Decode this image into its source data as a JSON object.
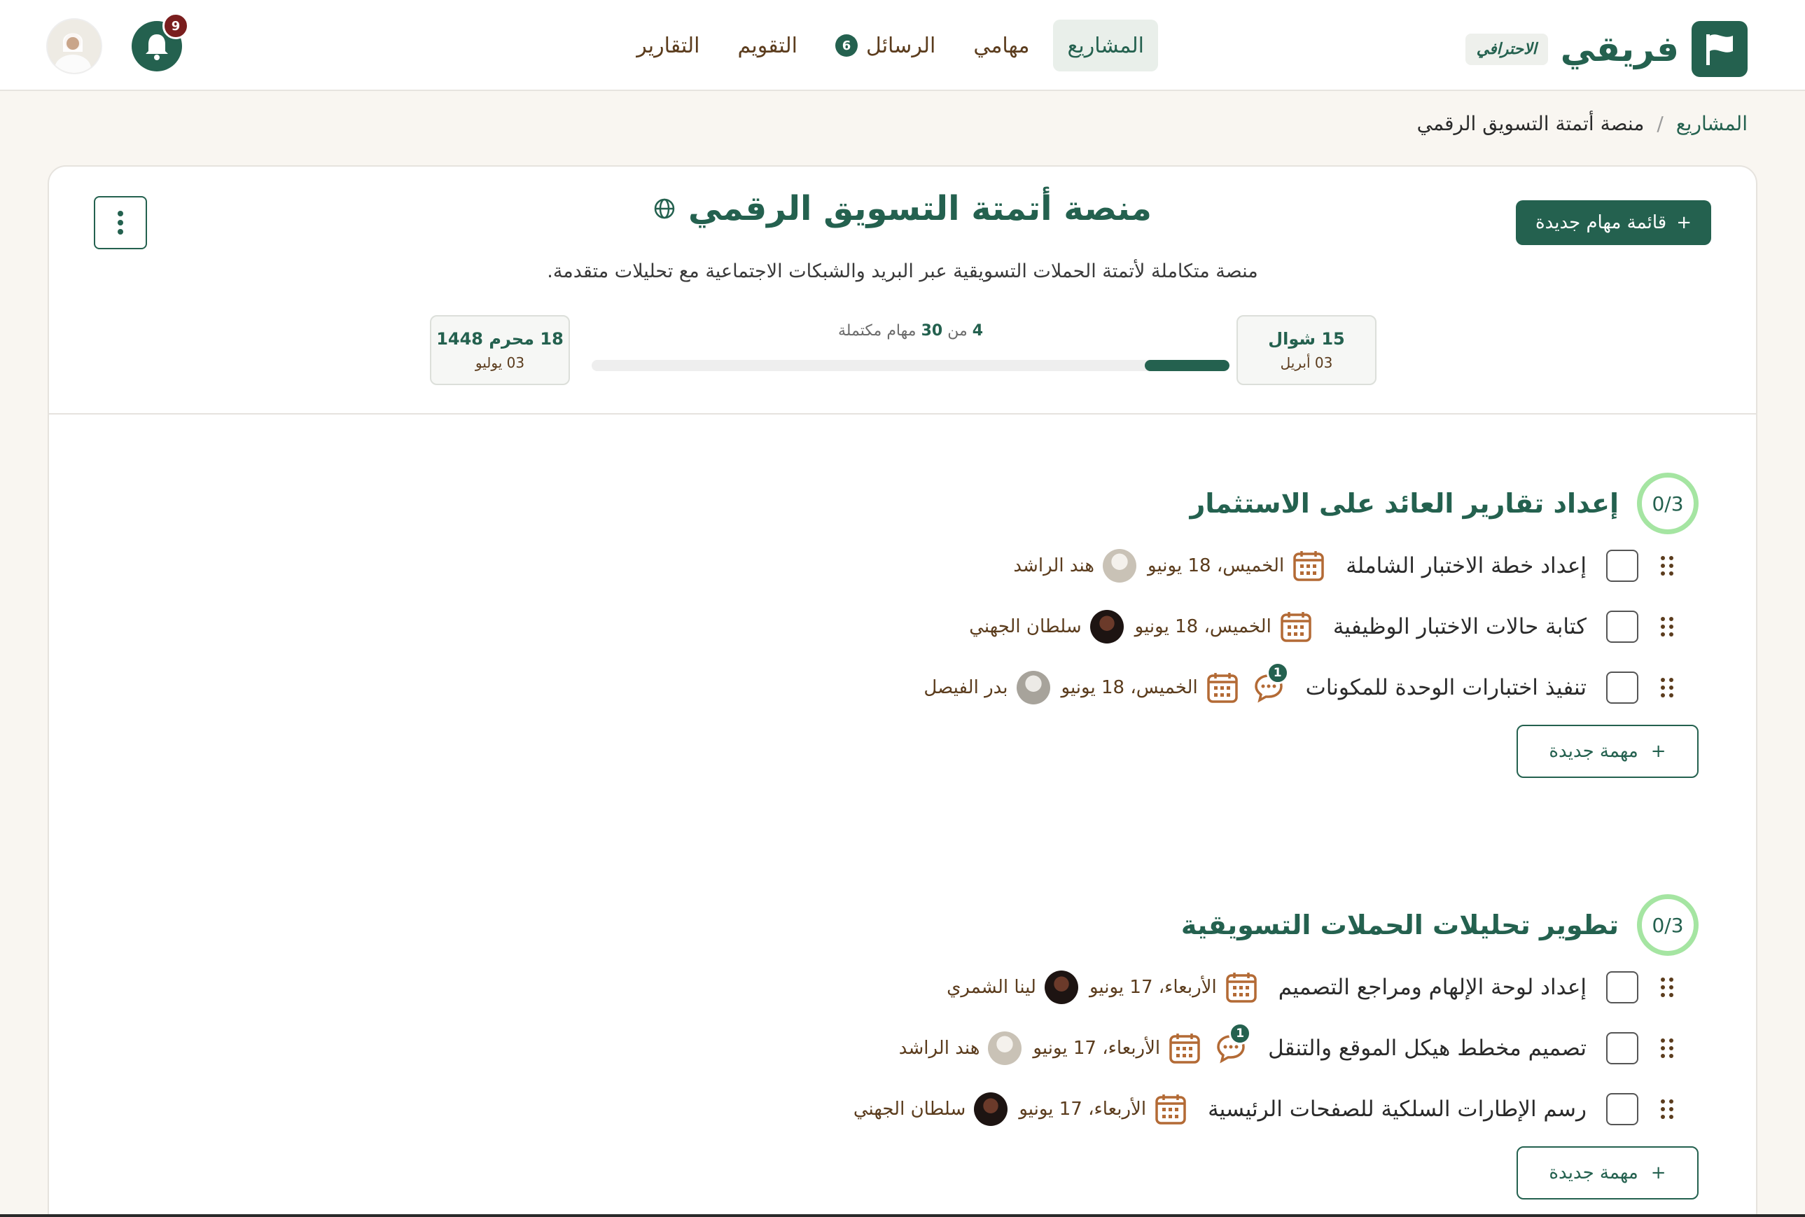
{
  "brand": {
    "name": "فريقي",
    "badge": "الاحترافي"
  },
  "nav": [
    {
      "label": "المشاريع",
      "active": true
    },
    {
      "label": "مهامي"
    },
    {
      "label": "الرسائل",
      "count": "6"
    },
    {
      "label": "التقويم"
    },
    {
      "label": "التقارير"
    }
  ],
  "notifications": {
    "count": "9"
  },
  "breadcrumb": {
    "root": "المشاريع",
    "separator": "/",
    "current": "منصة أتمتة التسويق الرقمي"
  },
  "project": {
    "title": "منصة أتمتة التسويق الرقمي",
    "description": "منصة متكاملة لأتمتة الحملات التسويقية عبر البريد والشبكات الاجتماعية مع تحليلات متقدمة.",
    "new_list_label": "قائمة مهام جديدة",
    "start": {
      "hijri": "15 شوال",
      "greg": "03 أبريل"
    },
    "end": {
      "hijri": "18 محرم 1448",
      "greg": "03 يوليو"
    },
    "progress": {
      "done": "4",
      "of": "من",
      "total": "30",
      "suffix": "مهام مكتملة",
      "fraction": 0.133
    }
  },
  "sections": [
    {
      "title": "إعداد تقارير العائد على الاستثمار",
      "count": "0/3",
      "new_task_label": "مهمة جديدة",
      "tasks": [
        {
          "name": "إعداد خطة الاختبار الشاملة",
          "date": "الخميس، 18 يونيو",
          "assignee": "هند الراشد",
          "avatar": "light"
        },
        {
          "name": "كتابة حالات الاختبار الوظيفية",
          "date": "الخميس، 18 يونيو",
          "assignee": "سلطان الجهني",
          "avatar": "dark"
        },
        {
          "name": "تنفيذ اختبارات الوحدة للمكونات",
          "date": "الخميس، 18 يونيو",
          "assignee": "بدر الفيصل",
          "avatar": "grey",
          "comments": "1"
        }
      ]
    },
    {
      "title": "تطوير تحليلات الحملات التسويقية",
      "count": "0/3",
      "new_task_label": "مهمة جديدة",
      "tasks": [
        {
          "name": "إعداد لوحة الإلهام ومراجع التصميم",
          "date": "الأربعاء، 17 يونيو",
          "assignee": "لينا الشمري",
          "avatar": "dark"
        },
        {
          "name": "تصميم مخطط هيكل الموقع والتنقل",
          "date": "الأربعاء، 17 يونيو",
          "assignee": "هند الراشد",
          "avatar": "light",
          "comments": "1"
        },
        {
          "name": "رسم الإطارات السلكية للصفحات الرئيسية",
          "date": "الأربعاء، 17 يونيو",
          "assignee": "سلطان الجهني",
          "avatar": "dark"
        }
      ]
    }
  ],
  "colors": {
    "primary": "#24614f",
    "accent_brown": "#5b3c1d",
    "ring": "#a5e5a2",
    "badge_red": "#7a1e1e",
    "page_bg": "#f9f6f1"
  }
}
